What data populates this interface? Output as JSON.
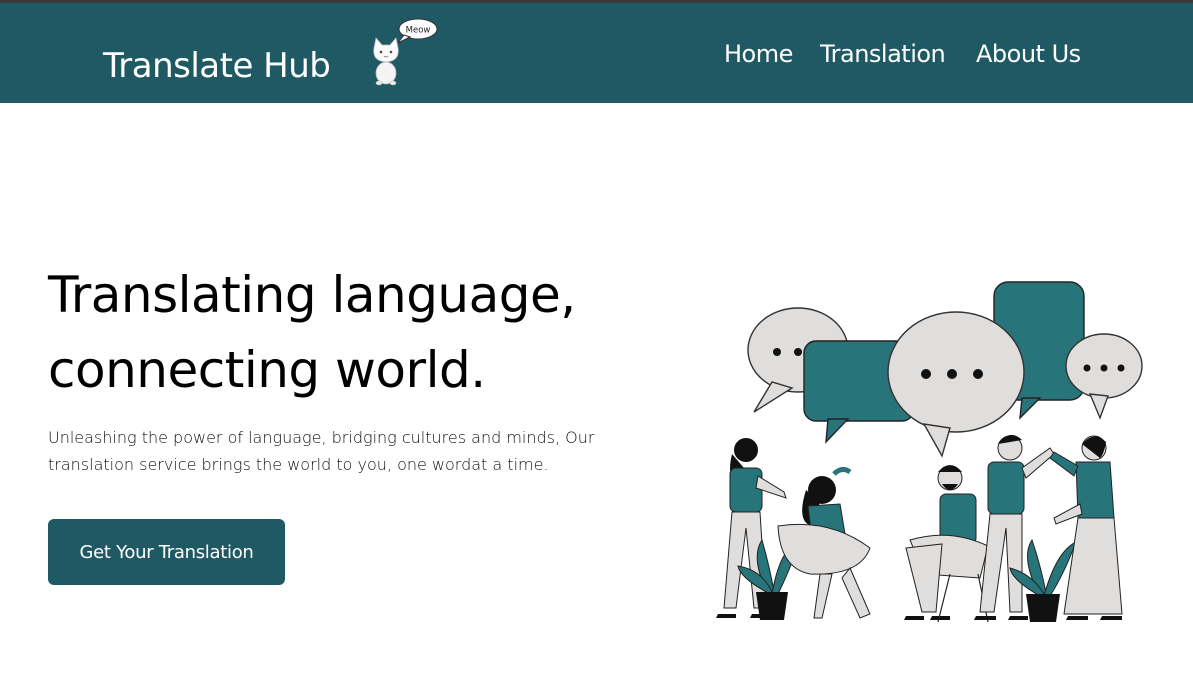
{
  "nav": {
    "brand": "Translate Hub",
    "mascot_bubble": "Meow",
    "links": [
      "Home",
      "Translation",
      "About Us"
    ]
  },
  "hero": {
    "title_line1": "Translating language,",
    "title_line2": "connecting world.",
    "subtitle": "Unleashing the power of language, bridging cultures and minds, Our translation service brings the world to you, one wordat a time.",
    "cta_label": "Get Your Translation"
  },
  "colors": {
    "nav_bg": "#1f5a64",
    "accent": "#27747a",
    "bubble_gray": "#e0dedc"
  }
}
